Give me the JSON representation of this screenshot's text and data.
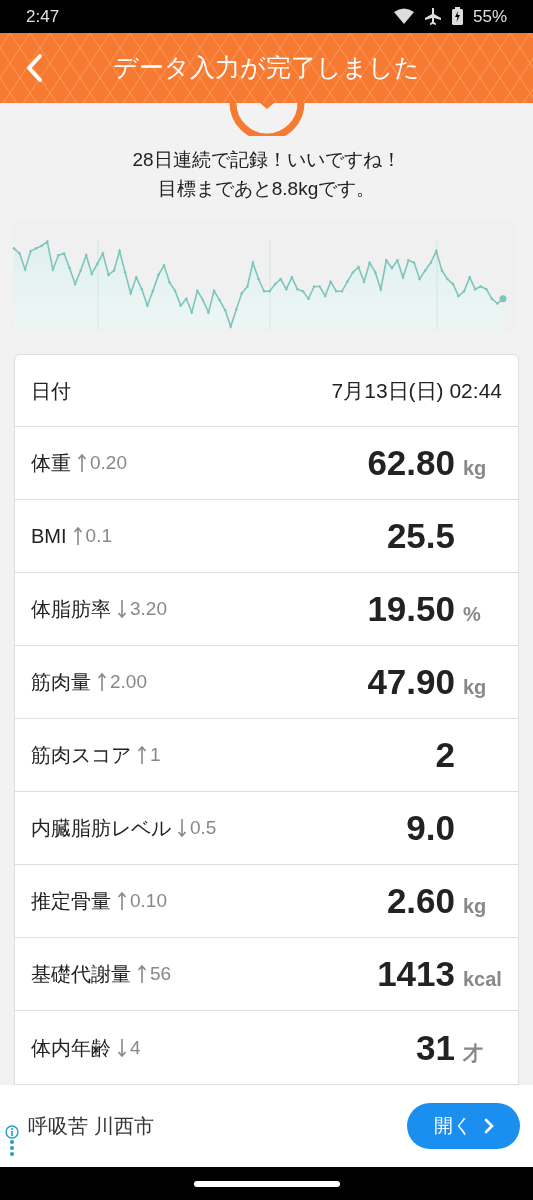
{
  "status_bar": {
    "time": "2:47",
    "battery": "55%"
  },
  "header": {
    "title": "データ入力が完了しました"
  },
  "message": [
    "28日連続で記録！いいですね！",
    "目標まであと8.8kgです。"
  ],
  "date_row": {
    "label": "日付",
    "value": "7月13日(日) 02:44"
  },
  "rows": [
    {
      "label": "体重",
      "increased": true,
      "delta": "0.20",
      "value": "62.80",
      "unit": "kg"
    },
    {
      "label": "BMI",
      "increased": true,
      "delta": "0.1",
      "value": "25.5"
    },
    {
      "label": "体脂肪率",
      "increased": false,
      "delta": "3.20",
      "value": "19.50",
      "unit": "%"
    },
    {
      "label": "筋肉量",
      "increased": true,
      "delta": "2.00",
      "value": "47.90",
      "unit": "kg"
    },
    {
      "label": "筋肉スコア",
      "increased": true,
      "delta": "1",
      "value": "2"
    },
    {
      "label": "内臓脂肪レベル",
      "increased": false,
      "delta": "0.5",
      "value": "9.0"
    },
    {
      "label": "推定骨量",
      "increased": true,
      "delta": "0.10",
      "value": "2.60",
      "unit": "kg"
    },
    {
      "label": "基礎代謝量",
      "increased": true,
      "delta": "56",
      "value": "1413",
      "unit": "kcal"
    },
    {
      "label": "体内年齢",
      "increased": false,
      "delta": "4",
      "value": "31",
      "unit": "才"
    }
  ],
  "ad": {
    "text": "呼吸苦 川西市",
    "button": "開く"
  }
}
